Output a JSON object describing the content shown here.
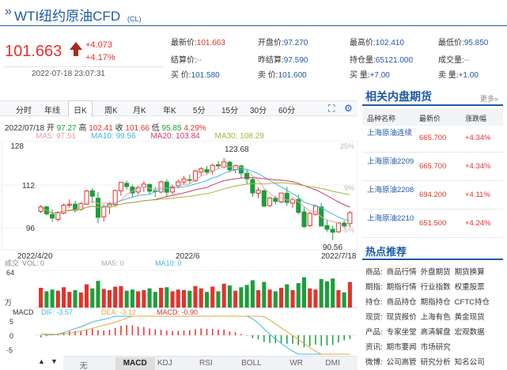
{
  "header": {
    "title": "WTI纽约原油CFD",
    "suffix": "(CL)",
    "price": "101.663",
    "change": "+4.073",
    "change_pct": "+4.17%",
    "timestamp": "2022-07-18 23:07:31"
  },
  "quote": [
    {
      "label": "最新价:",
      "value": "101.663",
      "color": "red"
    },
    {
      "label": "开盘价:",
      "value": "97.270",
      "color": "blue"
    },
    {
      "label": "最高价:",
      "value": "102.410",
      "color": "blue"
    },
    {
      "label": "最低价:",
      "value": "95.850",
      "color": "blue"
    },
    {
      "label": "结算价:",
      "value": "--",
      "color": "grey"
    },
    {
      "label": "昨结算:",
      "value": "97.590",
      "color": "blue"
    },
    {
      "label": "持仓量:",
      "value": "65121.000",
      "color": "blue"
    },
    {
      "label": "成交量:",
      "value": "--",
      "color": "grey"
    },
    {
      "label": "买  价:",
      "value": "101.580",
      "color": "blue"
    },
    {
      "label": "卖  价:",
      "value": "101.600",
      "color": "blue"
    },
    {
      "label": "买  量:",
      "value": "+7.00",
      "color": "blue"
    },
    {
      "label": "卖  量:",
      "value": "+1.00",
      "color": "blue"
    }
  ],
  "chart_tabs": [
    "分时",
    "年线",
    "日K",
    "周K",
    "月K",
    "年K",
    "5分",
    "15分",
    "30分",
    "60分"
  ],
  "active_tab": "日K",
  "ohlc": {
    "date": "2022/07/18",
    "open_lbl": "开",
    "open": "97.27",
    "high_lbl": "高",
    "high": "102.41",
    "close_lbl": "收",
    "close": "101.66",
    "low_lbl": "低",
    "low": "95.85",
    "pct": "4.29%"
  },
  "ma": {
    "ma5": "MA5: 97.51",
    "ma10": "MA10: 99.56",
    "ma20": "MA20: 103.84",
    "ma30": "MA30: 108.29"
  },
  "colors": {
    "ma5": "#e8a0b0",
    "ma10": "#3fb7e0",
    "ma20": "#d4386c",
    "ma30": "#a8b43a",
    "up": "#e3322b",
    "down": "#1b9e3a",
    "accent": "#1f5aa6"
  },
  "price_axis": {
    "top": "128",
    "mid": "112",
    "bottom": "96",
    "pct_top": "25%",
    "pct_mid": "9%",
    "pct_bot": "-6%"
  },
  "chart_annotations": {
    "high_mark": "123.68",
    "low_mark": "90.56",
    "date_left": "2022/4/20",
    "date_mid": "2022/6",
    "date_right": "2022/7/18"
  },
  "volume": {
    "label": "成交",
    "vol": "VOL: 0",
    "ma5": "MA5: 0",
    "ma10": "MA10: 0",
    "axis_top": "64",
    "axis_bot": "万"
  },
  "macd": {
    "label": "MACD",
    "dif": "DIF: -3.57",
    "dea": "DEA: -3.12",
    "macd": "MACD: -0.90",
    "axis_top": "5",
    "axis_mid": "0",
    "axis_bot": "-5"
  },
  "indicators": [
    "无",
    "MACD",
    "KDJ",
    "RSI",
    "BOLL",
    "WR",
    "DMI"
  ],
  "active_indicator": "MACD",
  "chart_data": {
    "type": "candlestick",
    "x_range": [
      "2022/4/20",
      "2022/7/18"
    ],
    "ylim": [
      88,
      130
    ],
    "candles": [
      [
        102.2,
        104.8,
        101.5,
        104.0
      ],
      [
        104.0,
        104.5,
        100.6,
        101.2
      ],
      [
        101.0,
        103.0,
        98.0,
        99.5
      ],
      [
        99.0,
        102.3,
        98.2,
        101.8
      ],
      [
        101.5,
        105.3,
        101.0,
        104.7
      ],
      [
        104.7,
        107.0,
        103.7,
        105.1
      ],
      [
        105.1,
        106.5,
        101.8,
        102.6
      ],
      [
        103.0,
        106.0,
        102.5,
        105.3
      ],
      [
        105.0,
        110.9,
        104.8,
        110.4
      ],
      [
        110.5,
        111.5,
        105.5,
        108.3
      ],
      [
        107.5,
        110.0,
        97.4,
        99.8
      ],
      [
        100.0,
        105.0,
        98.2,
        103.9
      ],
      [
        104.0,
        106.0,
        101.0,
        105.2
      ],
      [
        105.0,
        111.0,
        104.0,
        110.6
      ],
      [
        110.5,
        114.0,
        108.5,
        113.9
      ],
      [
        113.5,
        114.5,
        111.0,
        112.2
      ],
      [
        112.0,
        113.0,
        108.0,
        109.6
      ],
      [
        110.0,
        112.5,
        109.0,
        111.8
      ],
      [
        112.0,
        114.5,
        110.0,
        113.2
      ],
      [
        113.0,
        113.5,
        109.0,
        110.3
      ],
      [
        110.5,
        112.0,
        108.0,
        110.3
      ],
      [
        110.0,
        114.5,
        109.5,
        114.1
      ],
      [
        114.0,
        115.0,
        108.0,
        109.9
      ],
      [
        110.0,
        113.0,
        109.0,
        112.1
      ],
      [
        112.5,
        115.0,
        111.5,
        114.1
      ],
      [
        114.0,
        116.5,
        113.0,
        115.3
      ],
      [
        115.0,
        117.0,
        113.5,
        114.7
      ],
      [
        114.5,
        119.0,
        114.0,
        118.5
      ],
      [
        118.0,
        120.0,
        116.5,
        119.4
      ],
      [
        119.0,
        120.5,
        117.0,
        118.0
      ],
      [
        118.5,
        121.5,
        117.0,
        120.7
      ],
      [
        121.0,
        122.5,
        119.0,
        120.5
      ],
      [
        120.0,
        123.7,
        119.5,
        122.1
      ],
      [
        122.0,
        122.5,
        118.0,
        118.9
      ],
      [
        119.0,
        121.0,
        117.5,
        120.7
      ],
      [
        120.5,
        121.0,
        115.5,
        117.6
      ],
      [
        117.5,
        119.0,
        113.0,
        115.3
      ],
      [
        115.0,
        116.0,
        108.0,
        109.6
      ],
      [
        109.5,
        112.0,
        107.5,
        110.7
      ],
      [
        110.5,
        111.0,
        104.0,
        104.3
      ],
      [
        104.5,
        108.0,
        104.0,
        107.6
      ],
      [
        107.5,
        108.5,
        105.0,
        106.2
      ],
      [
        106.0,
        109.5,
        105.5,
        109.6
      ],
      [
        109.5,
        112.0,
        104.5,
        105.8
      ],
      [
        105.5,
        108.0,
        103.5,
        107.0
      ],
      [
        107.0,
        109.0,
        101.0,
        101.8
      ],
      [
        102.0,
        104.0,
        95.5,
        96.1
      ],
      [
        96.5,
        102.0,
        96.0,
        101.4
      ],
      [
        101.0,
        105.0,
        100.5,
        104.3
      ],
      [
        104.0,
        105.5,
        96.5,
        96.3
      ],
      [
        96.5,
        99.0,
        94.0,
        95.0
      ],
      [
        95.0,
        96.5,
        90.6,
        93.8
      ],
      [
        94.0,
        97.5,
        93.5,
        97.6
      ],
      [
        97.5,
        98.5,
        95.5,
        96.4
      ],
      [
        97.3,
        102.4,
        95.9,
        101.7
      ]
    ],
    "volume": [
      34,
      28,
      31,
      29,
      35,
      27,
      30,
      26,
      40,
      33,
      46,
      32,
      30,
      36,
      37,
      29,
      31,
      28,
      30,
      33,
      27,
      34,
      35,
      28,
      31,
      30,
      29,
      37,
      33,
      27,
      36,
      28,
      41,
      38,
      29,
      35,
      39,
      47,
      30,
      44,
      31,
      28,
      34,
      40,
      30,
      42,
      52,
      33,
      31,
      49,
      45,
      50,
      30,
      26,
      44
    ],
    "macd_hist": [
      -0.5,
      -0.2,
      0.0,
      0.3,
      0.6,
      0.9,
      1.0,
      1.0,
      1.3,
      1.5,
      1.2,
      1.1,
      1.3,
      1.7,
      2.2,
      2.4,
      2.3,
      2.0,
      1.9,
      1.6,
      1.4,
      1.3,
      1.1,
      1.0,
      1.0,
      1.1,
      1.2,
      1.4,
      1.6,
      1.5,
      1.5,
      1.3,
      1.3,
      0.9,
      0.7,
      0.3,
      -0.1,
      -0.7,
      -1.0,
      -1.6,
      -1.8,
      -1.9,
      -1.8,
      -2.0,
      -2.0,
      -2.3,
      -2.8,
      -2.6,
      -2.2,
      -2.5,
      -2.4,
      -2.3,
      -1.7,
      -1.2,
      -0.9
    ]
  },
  "related": {
    "title": "相关内盘期货",
    "more": "更多»",
    "headers": [
      "品种名称",
      "最新价",
      "涨跌幅"
    ],
    "rows": [
      {
        "name": "上海原油连续",
        "price": "665.700",
        "pct": "+4.34%"
      },
      {
        "name": "上海原油2209",
        "price": "665.700",
        "pct": "+4.34%"
      },
      {
        "name": "上海原油2208",
        "price": "694.200",
        "pct": "+4.11%"
      },
      {
        "name": "上海原油2210",
        "price": "651.500",
        "pct": "+4.24%"
      }
    ]
  },
  "hot": {
    "title": "热点推荐",
    "rows": [
      {
        "label": "商品:",
        "items": [
          "商品行情",
          "外盘期货",
          "期货换算"
        ]
      },
      {
        "label": "期指:",
        "items": [
          "期指行情",
          "行业指数",
          "权重股票"
        ]
      },
      {
        "label": "持仓:",
        "items": [
          "商品持仓",
          "期指持仓",
          "CFTC持仓"
        ]
      },
      {
        "label": "现货:",
        "items": [
          "现货报价",
          "上海有色",
          "黄金现货"
        ]
      },
      {
        "label": "产品:",
        "items": [
          "专家坐堂",
          "高清解盘",
          "宏观数据"
        ]
      },
      {
        "label": "资讯:",
        "items": [
          "期市要闻",
          "市场研究"
        ]
      },
      {
        "label": "微博:",
        "items": [
          "公司高管",
          "研究分析",
          "知名公司"
        ]
      }
    ]
  }
}
